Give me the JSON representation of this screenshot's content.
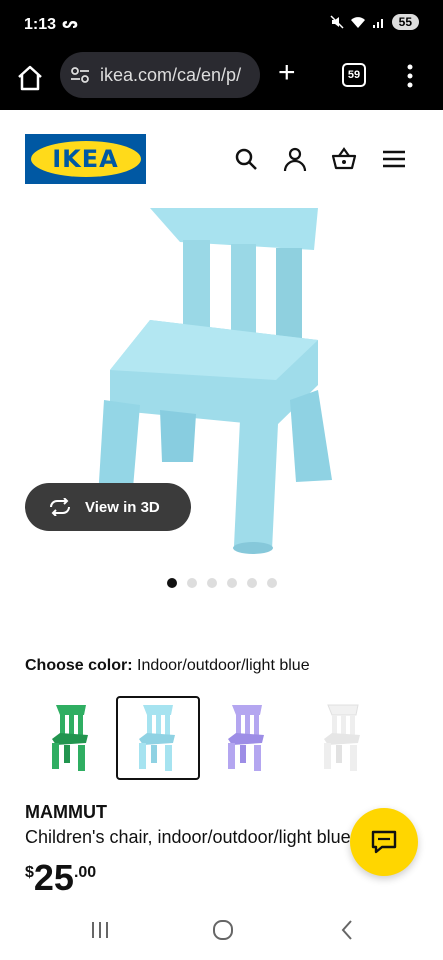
{
  "status_bar": {
    "time": "1:13",
    "extra": "ᔕ",
    "battery": "55"
  },
  "browser": {
    "url": "ikea.com/ca/en/p/",
    "tab_count": "59",
    "new_tab": "+"
  },
  "header": {
    "logo_text": "IKEA"
  },
  "product": {
    "view_3d_label": "View in 3D",
    "image_count": 6,
    "active_image": 1,
    "choose_color_label": "Choose color:",
    "selected_color": "Indoor/outdoor/light blue",
    "swatches": [
      {
        "name": "green",
        "color": "#2fae62"
      },
      {
        "name": "light blue",
        "color": "#9fe0ec"
      },
      {
        "name": "lilac",
        "color": "#b4a6f0"
      },
      {
        "name": "white",
        "color": "#f1f1f1"
      }
    ],
    "selected_swatch": 2,
    "name": "MAMMUT",
    "description": "Children's chair, indoor/outdoor/light blue",
    "price_currency": "$",
    "price_int": "25",
    "price_dec": ".00"
  },
  "colors": {
    "chair": "#a6e3f0",
    "accent": "#ffd600",
    "ikea_blue": "#0058a3",
    "ikea_yellow": "#ffda1a"
  },
  "icons": [
    "home-icon",
    "site-settings-icon",
    "search-icon",
    "person-icon",
    "basket-icon",
    "hamburger-icon",
    "rotate-3d-icon",
    "chat-icon"
  ]
}
